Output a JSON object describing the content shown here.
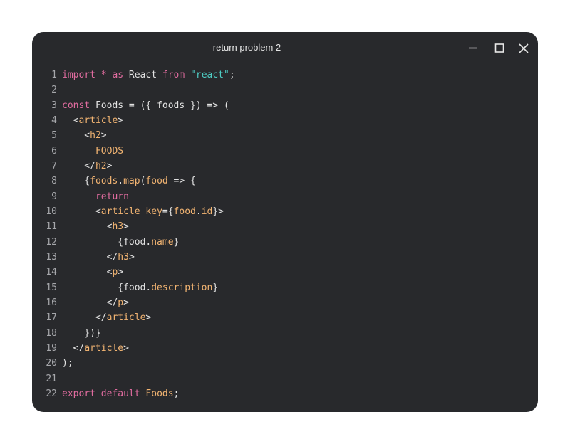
{
  "window": {
    "title": "return problem 2",
    "controls": [
      "minimize-icon",
      "maximize-icon",
      "close-icon"
    ]
  },
  "colors": {
    "background": "#28292c",
    "keyword": "#e06c9f",
    "string": "#4ecdc4",
    "tag": "#f2b472",
    "text": "#e3e3e3",
    "line_number": "#a6a7ab"
  },
  "code": {
    "lines": [
      {
        "n": "1",
        "tokens": [
          [
            "kw",
            "import"
          ],
          [
            "op",
            " "
          ],
          [
            "kw",
            "*"
          ],
          [
            "op",
            " "
          ],
          [
            "kw",
            "as"
          ],
          [
            "op",
            " React "
          ],
          [
            "kw",
            "from"
          ],
          [
            "op",
            " "
          ],
          [
            "str",
            "\"react\""
          ],
          [
            "op",
            ";"
          ]
        ]
      },
      {
        "n": "2",
        "tokens": []
      },
      {
        "n": "3",
        "tokens": [
          [
            "kw",
            "const"
          ],
          [
            "op",
            " Foods = ({ foods }) => ("
          ]
        ]
      },
      {
        "n": "4",
        "tokens": [
          [
            "op",
            "  <"
          ],
          [
            "tag",
            "article"
          ],
          [
            "op",
            ">"
          ]
        ]
      },
      {
        "n": "5",
        "tokens": [
          [
            "op",
            "    <"
          ],
          [
            "tag",
            "h2"
          ],
          [
            "op",
            ">"
          ]
        ]
      },
      {
        "n": "6",
        "tokens": [
          [
            "tag",
            "      FOODS"
          ]
        ]
      },
      {
        "n": "7",
        "tokens": [
          [
            "op",
            "    </"
          ],
          [
            "tag",
            "h2"
          ],
          [
            "op",
            ">"
          ]
        ]
      },
      {
        "n": "8",
        "tokens": [
          [
            "op",
            "    {"
          ],
          [
            "prop",
            "foods"
          ],
          [
            "op",
            "."
          ],
          [
            "prop",
            "map"
          ],
          [
            "op",
            "("
          ],
          [
            "prop",
            "food"
          ],
          [
            "op",
            " => {"
          ]
        ]
      },
      {
        "n": "9",
        "tokens": [
          [
            "kw",
            "      return"
          ]
        ]
      },
      {
        "n": "10",
        "tokens": [
          [
            "op",
            "      <"
          ],
          [
            "tag",
            "article key"
          ],
          [
            "op",
            "={"
          ],
          [
            "prop",
            "food"
          ],
          [
            "op",
            "."
          ],
          [
            "prop",
            "id"
          ],
          [
            "op",
            "}>"
          ]
        ]
      },
      {
        "n": "11",
        "tokens": [
          [
            "op",
            "        <"
          ],
          [
            "tag",
            "h3"
          ],
          [
            "op",
            ">"
          ]
        ]
      },
      {
        "n": "12",
        "tokens": [
          [
            "op",
            "          {food."
          ],
          [
            "prop",
            "name"
          ],
          [
            "op",
            "}"
          ]
        ]
      },
      {
        "n": "13",
        "tokens": [
          [
            "op",
            "        </"
          ],
          [
            "tag",
            "h3"
          ],
          [
            "op",
            ">"
          ]
        ]
      },
      {
        "n": "14",
        "tokens": [
          [
            "op",
            "        <"
          ],
          [
            "tag",
            "p"
          ],
          [
            "op",
            ">"
          ]
        ]
      },
      {
        "n": "15",
        "tokens": [
          [
            "op",
            "          {food."
          ],
          [
            "prop",
            "description"
          ],
          [
            "op",
            "}"
          ]
        ]
      },
      {
        "n": "16",
        "tokens": [
          [
            "op",
            "        </"
          ],
          [
            "tag",
            "p"
          ],
          [
            "op",
            ">"
          ]
        ]
      },
      {
        "n": "17",
        "tokens": [
          [
            "op",
            "      </"
          ],
          [
            "tag",
            "article"
          ],
          [
            "op",
            ">"
          ]
        ]
      },
      {
        "n": "18",
        "tokens": [
          [
            "op",
            "    })}"
          ]
        ]
      },
      {
        "n": "19",
        "tokens": [
          [
            "op",
            "  </"
          ],
          [
            "tag",
            "article"
          ],
          [
            "op",
            ">"
          ]
        ]
      },
      {
        "n": "20",
        "tokens": [
          [
            "op",
            ");"
          ]
        ]
      },
      {
        "n": "21",
        "tokens": []
      },
      {
        "n": "22",
        "tokens": [
          [
            "kw",
            "export"
          ],
          [
            "op",
            " "
          ],
          [
            "kw",
            "default"
          ],
          [
            "op",
            " "
          ],
          [
            "tag",
            "Foods"
          ],
          [
            "op",
            ";"
          ]
        ]
      }
    ]
  }
}
